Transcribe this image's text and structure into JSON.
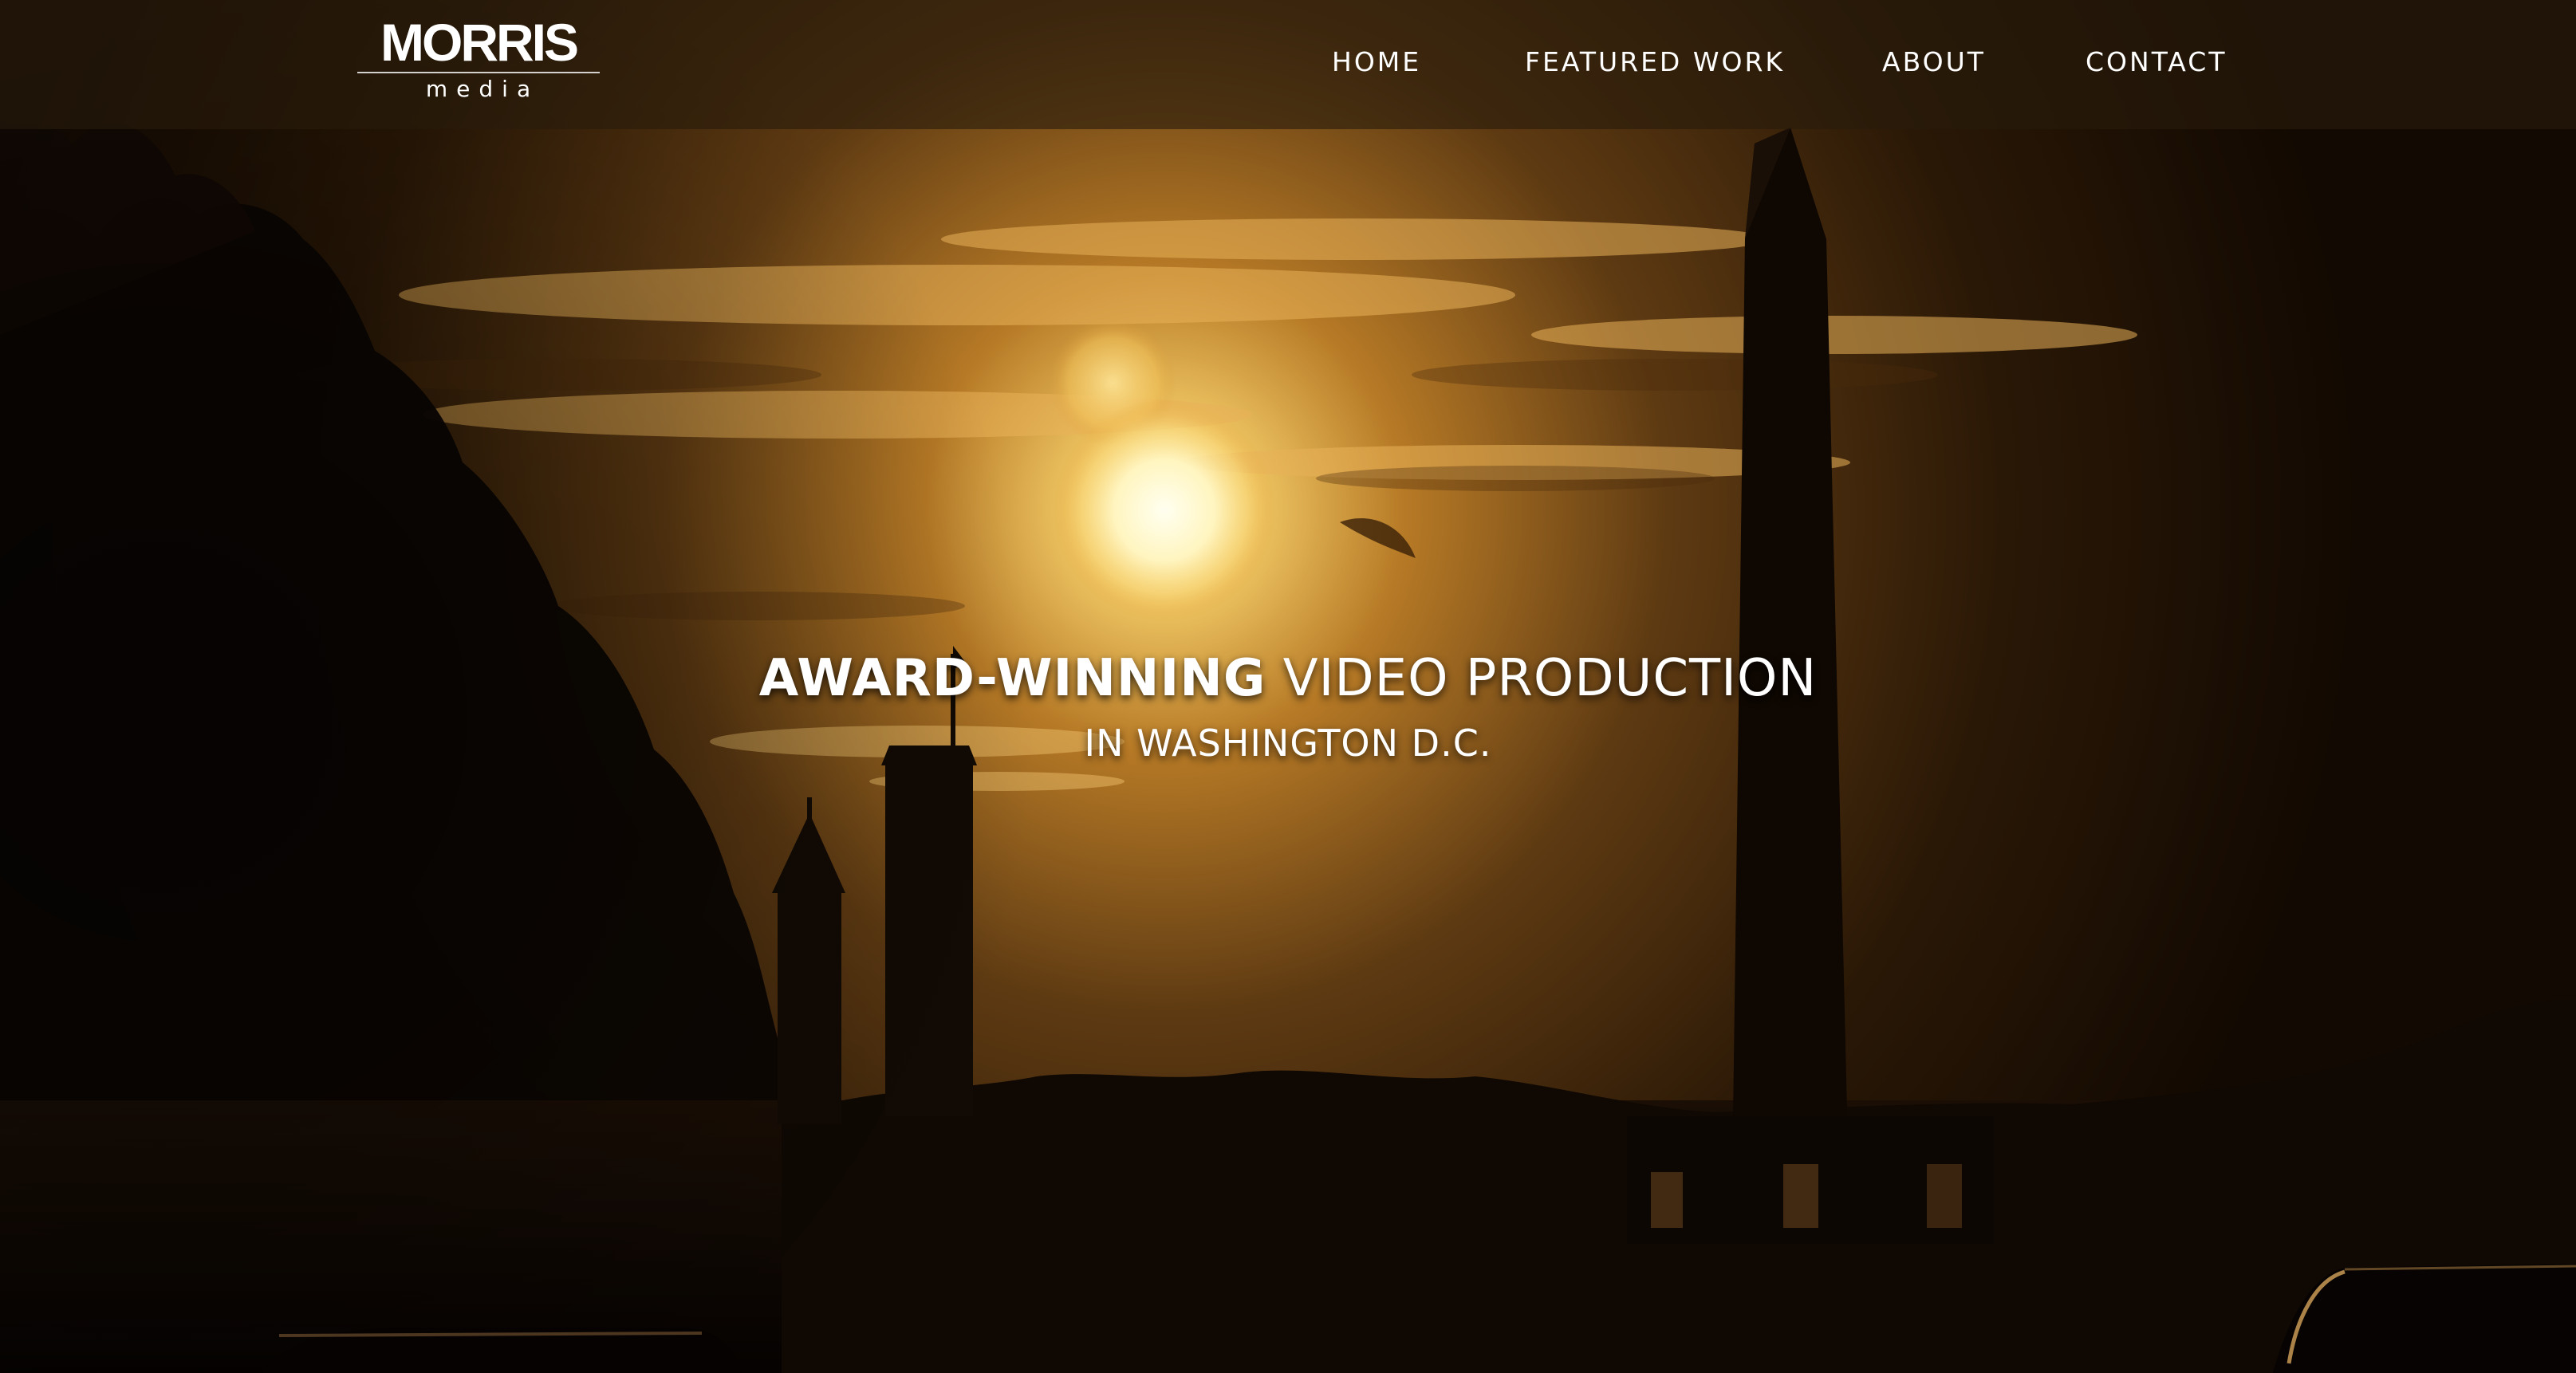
{
  "brand": {
    "name": "MORRIS",
    "subtitle": "media"
  },
  "nav": {
    "items": [
      {
        "label": "HOME"
      },
      {
        "label": "FEATURED WORK"
      },
      {
        "label": "ABOUT"
      },
      {
        "label": "CONTACT"
      }
    ]
  },
  "hero": {
    "headline_strong": "AWARD-WINNING",
    "headline_rest": " VIDEO PRODUCTION",
    "subheadline": "IN WASHINGTON D.C."
  },
  "colors": {
    "header_bg": "#281c0c",
    "sky_glow": "#f2c15a",
    "text": "#ffffff"
  }
}
